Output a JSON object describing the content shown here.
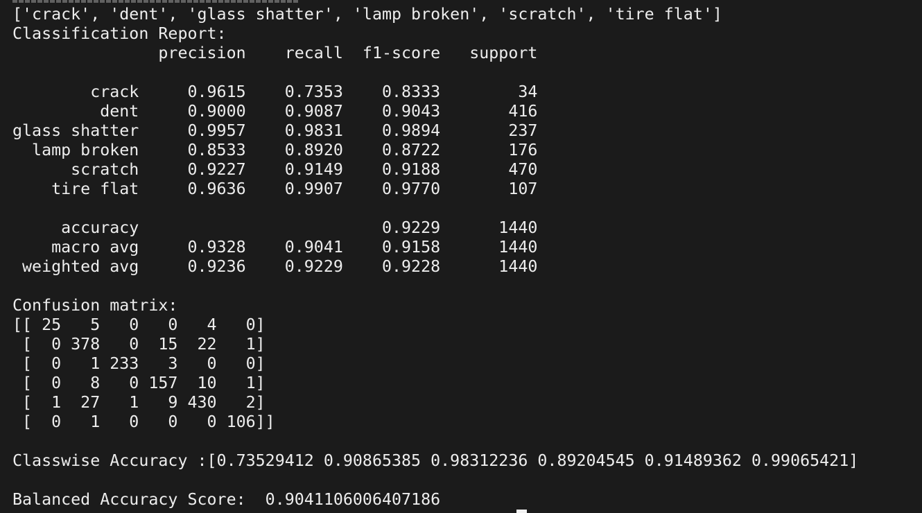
{
  "terminal": {
    "labels_line": "['crack', 'dent', 'glass shatter', 'lamp broken', 'scratch', 'tire flat']",
    "report_title": "Classification Report:",
    "report_header": "               precision    recall  f1-score   support",
    "report_rows": [
      "        crack     0.9615    0.7353    0.8333        34",
      "         dent     0.9000    0.9087    0.9043       416",
      "glass shatter     0.9957    0.9831    0.9894       237",
      "  lamp broken     0.8533    0.8920    0.8722       176",
      "      scratch     0.9227    0.9149    0.9188       470",
      "    tire flat     0.9636    0.9907    0.9770       107"
    ],
    "summary_rows": [
      "     accuracy                         0.9229      1440",
      "    macro avg     0.9328    0.9041    0.9158      1440",
      " weighted avg     0.9236    0.9229    0.9228      1440"
    ],
    "confusion_title": "Confusion matrix:",
    "confusion_rows": [
      "[[ 25   5   0   0   4   0]",
      " [  0 378   0  15  22   1]",
      " [  0   1 233   3   0   0]",
      " [  0   8   0 157  10   1]",
      " [  1  27   1   9 430   2]",
      " [  0   1   0   0   0 106]]"
    ],
    "classwise_line": "Classwise Accuracy :[0.73529412 0.90865385 0.98312236 0.89204545 0.91489362 0.99065421]",
    "balanced_line": "Balanced Accuracy Score:  0.9041106006407186"
  }
}
